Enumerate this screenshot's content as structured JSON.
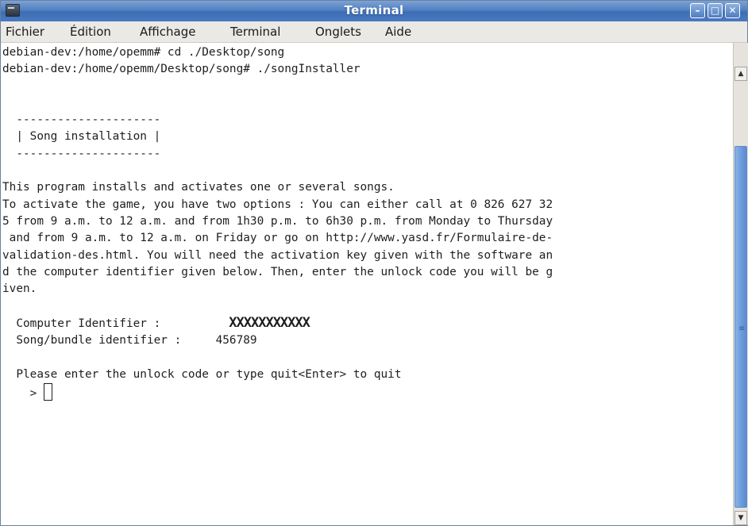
{
  "window": {
    "title": "Terminal",
    "icon": "terminal-icon",
    "controls": {
      "minimize": "–",
      "maximize": "□",
      "close": "✕"
    }
  },
  "menu": {
    "items": [
      "Fichier",
      "Édition",
      "Affichage",
      "Terminal",
      "Onglets",
      "Aide"
    ]
  },
  "terminal": {
    "lines": [
      "debian-dev:/home/opemm# cd ./Desktop/song",
      "debian-dev:/home/opemm/Desktop/song# ./songInstaller",
      "",
      "",
      "  ---------------------",
      "  | Song installation |",
      "  ---------------------",
      "",
      "This program installs and activates one or several songs.",
      "To activate the game, you have two options : You can either call at 0 826 627 32",
      "5 from 9 a.m. to 12 a.m. and from 1h30 p.m. to 6h30 p.m. from Monday to Thursday",
      " and from 9 a.m. to 12 a.m. on Friday or go on http://www.yasd.fr/Formulaire-de-",
      "validation-des.html. You will need the activation key given with the software an",
      "d the computer identifier given below. Then, enter the unlock code you will be g",
      "iven.",
      "",
      "  Computer Identifier :",
      "  Song/bundle identifier :     456789",
      "",
      "  Please enter the unlock code or type quit<Enter> to quit",
      "    > "
    ],
    "computer_identifier_value": "XXXXXXXXXXX"
  },
  "scrollbar": {
    "up": "▲",
    "down": "▼",
    "grip": "≡"
  }
}
